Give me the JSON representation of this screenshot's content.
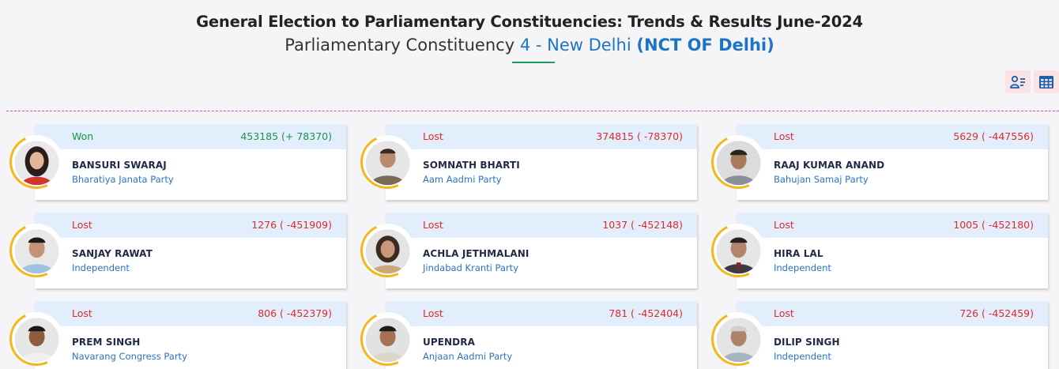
{
  "header": {
    "title": "General Election to Parliamentary Constituencies: Trends & Results June-2024",
    "subtitle_prefix": "Parliamentary Constituency",
    "constituency": "4 - New Delhi",
    "state": "(NCT OF Delhi)"
  },
  "toolbar": {
    "icons": [
      "candidate-list-icon",
      "table-grid-icon"
    ]
  },
  "colors": {
    "won": "#1a9448",
    "lost": "#e02a2a",
    "accent_blue": "#1d74c4",
    "photo_ring": "#f3b71c",
    "card_band": "#e2eefb",
    "divider": "#d94db8"
  },
  "candidates": [
    {
      "status": "Won",
      "votes": "453185 (+ 78370)",
      "name": "BANSURI SWARAJ",
      "party": "Bharatiya Janata Party"
    },
    {
      "status": "Lost",
      "votes": "374815 ( -78370)",
      "name": "SOMNATH BHARTI",
      "party": "Aam Aadmi Party"
    },
    {
      "status": "Lost",
      "votes": "5629 ( -447556)",
      "name": "RAAJ KUMAR ANAND",
      "party": "Bahujan Samaj Party"
    },
    {
      "status": "Lost",
      "votes": "1276 ( -451909)",
      "name": "SANJAY RAWAT",
      "party": "Independent"
    },
    {
      "status": "Lost",
      "votes": "1037 ( -452148)",
      "name": "ACHLA JETHMALANI",
      "party": "Jindabad Kranti Party"
    },
    {
      "status": "Lost",
      "votes": "1005 ( -452180)",
      "name": "HIRA LAL",
      "party": "Independent"
    },
    {
      "status": "Lost",
      "votes": "806 ( -452379)",
      "name": "PREM SINGH",
      "party": "Navarang Congress Party"
    },
    {
      "status": "Lost",
      "votes": "781 ( -452404)",
      "name": "UPENDRA",
      "party": "Anjaan Aadmi Party"
    },
    {
      "status": "Lost",
      "votes": "726 ( -452459)",
      "name": "DILIP SINGH",
      "party": "Independent"
    }
  ]
}
